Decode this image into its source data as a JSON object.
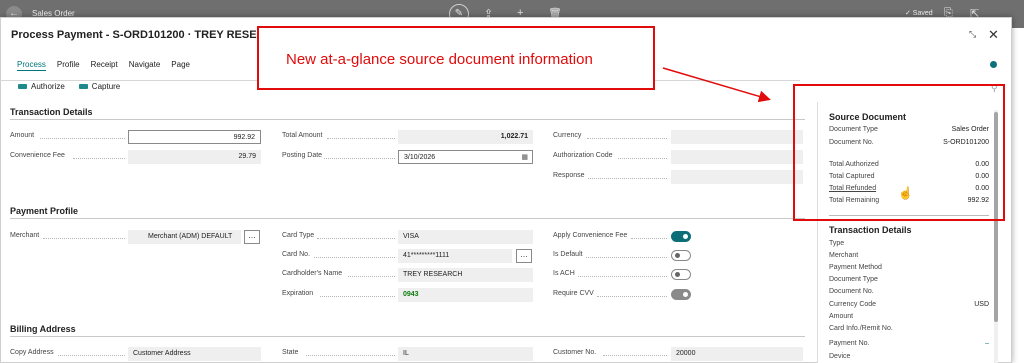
{
  "topbar": {
    "title": "Sales Order",
    "saved": "✓ Saved"
  },
  "dialog": {
    "title": "Process Payment - S-ORD101200 · TREY RESEARCH",
    "menu": [
      "Process",
      "Profile",
      "Receipt",
      "Navigate",
      "Page"
    ],
    "actions": [
      "Authorize",
      "Capture"
    ]
  },
  "transaction": {
    "header": "Transaction Details",
    "amount_label": "Amount",
    "amount_value": "992.92",
    "conv_fee_label": "Convenience Fee",
    "conv_fee_value": "29.79",
    "total_amount_label": "Total Amount",
    "total_amount_value": "1,022.71",
    "posting_date_label": "Posting Date",
    "posting_date_value": "3/10/2026",
    "currency_label": "Currency",
    "currency_value": "",
    "auth_code_label": "Authorization Code",
    "auth_code_value": "",
    "response_label": "Response",
    "response_value": ""
  },
  "profile": {
    "header": "Payment Profile",
    "merchant_label": "Merchant",
    "merchant_value": "Merchant (ADM) DEFAULT",
    "card_type_label": "Card Type",
    "card_type_value": "VISA",
    "card_no_label": "Card No.",
    "card_no_value": "41*********1111",
    "cardholder_label": "Cardholder's Name",
    "cardholder_value": "TREY RESEARCH",
    "expiration_label": "Expiration",
    "expiration_value": "0943",
    "apply_conv_label": "Apply Convenience Fee",
    "apply_conv_value": "on",
    "is_default_label": "Is Default",
    "is_default_value": "off",
    "is_ach_label": "Is ACH",
    "is_ach_value": "off",
    "require_cvv_label": "Require CVV",
    "require_cvv_value": "on"
  },
  "billing": {
    "header": "Billing Address",
    "copy_label": "Copy Address",
    "copy_value": "Customer Address",
    "state_label": "State",
    "state_value": "IL",
    "customer_no_label": "Customer No.",
    "customer_no_value": "20000"
  },
  "factbox": {
    "source_header": "Source Document",
    "source_rows": [
      {
        "k": "Document Type",
        "v": "Sales Order"
      },
      {
        "k": "Document No.",
        "v": "S-ORD101200"
      },
      {
        "k": "Total Authorized",
        "v": "0.00"
      },
      {
        "k": "Total Captured",
        "v": "0.00"
      },
      {
        "k": "Total Refunded",
        "v": "0.00"
      },
      {
        "k": "Total Remaining",
        "v": "992.92"
      }
    ],
    "tx_header": "Transaction Details",
    "tx_rows": [
      {
        "k": "Type",
        "v": ""
      },
      {
        "k": "Merchant",
        "v": ""
      },
      {
        "k": "Payment Method",
        "v": ""
      },
      {
        "k": "Document Type",
        "v": ""
      },
      {
        "k": "Document No.",
        "v": ""
      },
      {
        "k": "Currency Code",
        "v": "USD"
      },
      {
        "k": "Amount",
        "v": ""
      },
      {
        "k": "Card Info./Remit No.",
        "v": ""
      },
      {
        "k": "Payment No.",
        "v": "–"
      },
      {
        "k": "Device",
        "v": ""
      }
    ]
  },
  "annotation": {
    "text": "New at-a-glance source document information",
    "color": "#e10b0b"
  },
  "colors": {
    "accent": "#00757a",
    "toggle_on": "#0d6e78"
  }
}
